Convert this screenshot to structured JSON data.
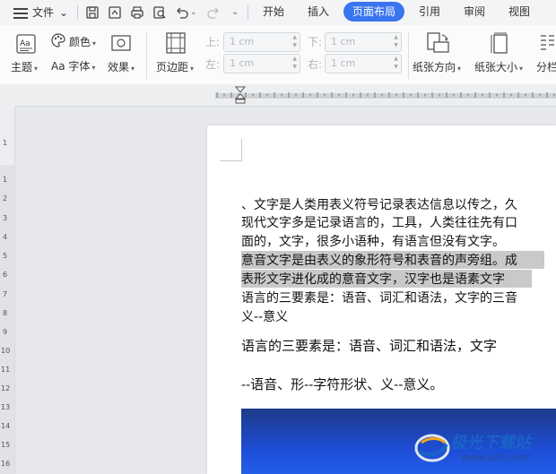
{
  "menubar": {
    "file_label": "文件",
    "tabs": [
      "开始",
      "插入",
      "页面布局",
      "引用",
      "审阅",
      "视图"
    ],
    "active_tab": "页面布局",
    "accent": "#3a75f0"
  },
  "ribbon": {
    "theme_label": "主题",
    "color_label": "颜色",
    "font_label": "Aa 字体",
    "effect_label": "效果",
    "margins_label": "页边距",
    "top_label": "上:",
    "bottom_label": "下:",
    "left_label": "左:",
    "right_label": "右:",
    "top_value": "1 cm",
    "bottom_value": "1 cm",
    "left_value": "1 cm",
    "right_value": "1 cm",
    "orientation_label": "纸张方向",
    "size_label": "纸张大小",
    "columns_label": "分栏"
  },
  "vruler": [
    "1",
    "1",
    "2",
    "3",
    "4",
    "5",
    "6",
    "7",
    "8",
    "9",
    "10",
    "11",
    "12",
    "13",
    "14",
    "15",
    "16"
  ],
  "document": {
    "lines": [
      "、文字是人类用表义符号记录表达信息以传之，久",
      "现代文字多是记录语言的，工具，人类往往先有口",
      "面的，文字，很多小语种，有语言但没有文字。",
      "意音文字是由表义的象形符号和表音的声旁组。成",
      "表形文字进化成的意音文字，汉字也是语素文字",
      "语言的三要素是：语音、词汇和语法，文字的三音",
      "义--意义",
      "语言的三要素是：语音、词汇和语法，文字",
      "--语音、形--字符形状、义--意义。"
    ]
  },
  "watermark": {
    "title": "极光下载站",
    "url": "www.xz7.com"
  }
}
